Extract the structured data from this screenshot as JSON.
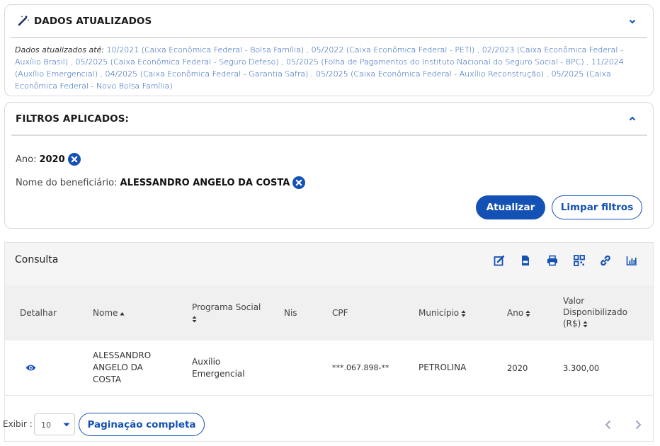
{
  "dados": {
    "title": "DADOS ATUALIZADOS",
    "lead": "Dados atualizados até: ",
    "text": "10/2021 (Caixa Econômica Federal - Bolsa Família) , 05/2022 (Caixa Econômica Federal - PETI) , 02/2023 (Caixa Econômica Federal - Auxílio Brasil) , 05/2025 (Caixa Econômica Federal - Seguro Defeso) , 05/2025 (Folha de Pagamentos do Instituto Nacional do Seguro Social - BPC) , 11/2024 (Auxílio Emergencial) , 04/2025 (Caixa Econômica Federal - Garantia Safra) , 05/2025 (Caixa Econômica Federal - Auxílio Reconstrução) , 05/2025 (Caixa Econômica Federal - Novo Bolsa Família)"
  },
  "filtros": {
    "title": "FILTROS APLICADOS:",
    "ano_label": "Ano:",
    "ano_value": "2020",
    "nome_label": "Nome do beneficiário:",
    "nome_value": "ALESSANDRO ANGELO DA COSTA",
    "atualizar": "Atualizar",
    "limpar": "Limpar filtros"
  },
  "table": {
    "title": "Consulta",
    "headers": {
      "detalhar": "Detalhar",
      "nome": "Nome",
      "programa": "Programa Social",
      "nis": "Nis",
      "cpf": "CPF",
      "municipio": "Município",
      "ano": "Ano",
      "valor_1": "Valor",
      "valor_2": "Disponibilizado",
      "valor_3": "(R$)"
    },
    "rows": [
      {
        "nome_1": "ALESSANDRO",
        "nome_2": "ANGELO DA",
        "nome_3": "COSTA",
        "programa_1": "Auxílio",
        "programa_2": "Emergencial",
        "nis": "",
        "cpf": "***.067.898-**",
        "municipio": "PETROLINA",
        "ano": "2020",
        "valor": "3.300,00"
      }
    ]
  },
  "pager": {
    "exibir": "Exibir :",
    "page_size": "10",
    "paginacao": "Paginação completa"
  },
  "colors": {
    "primary": "#1351b4",
    "text": "#333333"
  }
}
